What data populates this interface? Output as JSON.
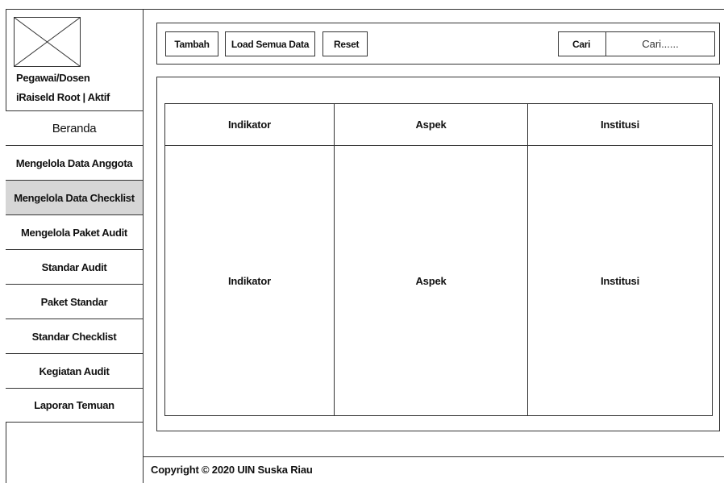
{
  "user": {
    "role": "Pegawai/Dosen",
    "status": "iRaiseld Root | Aktif"
  },
  "sidebar": {
    "items": [
      {
        "label": "Beranda"
      },
      {
        "label": "Mengelola Data Anggota"
      },
      {
        "label": "Mengelola Data Checklist"
      },
      {
        "label": "Mengelola Paket Audit"
      },
      {
        "label": "Standar Audit"
      },
      {
        "label": "Paket Standar"
      },
      {
        "label": "Standar Checklist"
      },
      {
        "label": "Kegiatan Audit"
      },
      {
        "label": "Laporan Temuan"
      }
    ],
    "active_index": 2
  },
  "toolbar": {
    "add_label": "Tambah",
    "load_all_label": "Load Semua Data",
    "reset_label": "Reset",
    "search_label": "Cari",
    "search_placeholder": "Cari......"
  },
  "table": {
    "headers": [
      "Indikator",
      "Aspek",
      "Institusi"
    ],
    "rows": [
      [
        "Indikator",
        "Aspek",
        "Institusi"
      ]
    ]
  },
  "footer": {
    "copyright": "Copyright © 2020 UIN Suska Riau"
  },
  "colors": {
    "active_nav_bg": "#d6d6d6",
    "border": "#333333"
  }
}
